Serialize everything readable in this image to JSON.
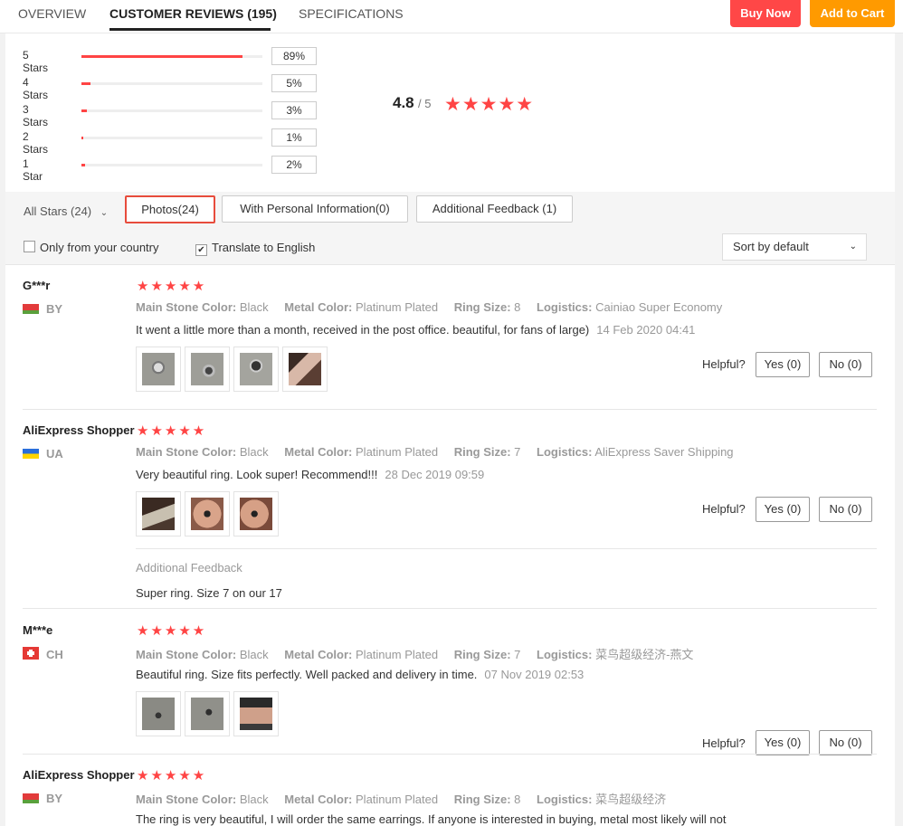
{
  "tabs": {
    "overview": "OVERVIEW",
    "reviews": "CUSTOMER REVIEWS (195)",
    "specs": "SPECIFICATIONS"
  },
  "actions": {
    "buy_now": "Buy Now",
    "add_to_cart": "Add to Cart"
  },
  "rating_breakdown": [
    {
      "label": "5 Stars",
      "percent_text": "89%",
      "percent": 89
    },
    {
      "label": "4 Stars",
      "percent_text": "5%",
      "percent": 5
    },
    {
      "label": "3 Stars",
      "percent_text": "3%",
      "percent": 3
    },
    {
      "label": "2 Stars",
      "percent_text": "1%",
      "percent": 1
    },
    {
      "label": "1 Star",
      "percent_text": "2%",
      "percent": 2
    }
  ],
  "overall": {
    "score": "4.8",
    "out_of": "/ 5",
    "stars": "★★★★★"
  },
  "filters": {
    "all_stars": "All Stars (24)",
    "all_stars_chevron": "⌄",
    "photos": "Photos(24)",
    "personal_info": "With Personal Information(0)",
    "additional_feedback": "Additional Feedback (1)",
    "only_country": "Only from your country",
    "translate": "Translate to English",
    "sort": "Sort by default",
    "sort_chevron": "⌄",
    "translate_check": "✔"
  },
  "labels": {
    "main_stone_color": "Main Stone Color:",
    "metal_color": "Metal Color:",
    "ring_size": "Ring Size:",
    "logistics": "Logistics:",
    "helpful": "Helpful?",
    "additional_feedback": "Additional Feedback"
  },
  "reviews": [
    {
      "name": "G***r",
      "country": "BY",
      "stars": "★★★★★",
      "main_stone_color": "Black",
      "metal_color": "Platinum Plated",
      "ring_size": "8",
      "logistics": "Cainiao Super Economy",
      "comment": "It went a little more than a month, received in the post office. beautiful, for fans of large)",
      "date": "14 Feb 2020 04:41",
      "yes": "Yes (0)",
      "no": "No (0)"
    },
    {
      "name": "AliExpress Shopper",
      "country": "UA",
      "stars": "★★★★★",
      "main_stone_color": "Black",
      "metal_color": "Platinum Plated",
      "ring_size": "7",
      "logistics": "AliExpress Saver Shipping",
      "comment": "Very beautiful ring. Look super! Recommend!!!",
      "date": "28 Dec 2019 09:59",
      "yes": "Yes (0)",
      "no": "No (0)",
      "additional_feedback": "Super ring. Size 7 on our 17"
    },
    {
      "name": "M***e",
      "country": "CH",
      "stars": "★★★★★",
      "main_stone_color": "Black",
      "metal_color": "Platinum Plated",
      "ring_size": "7",
      "logistics": "菜鸟超级经济-燕文",
      "comment": "Beautiful ring. Size fits perfectly. Well packed and delivery in time.",
      "date": "07 Nov 2019 02:53",
      "yes": "Yes (0)",
      "no": "No (0)"
    },
    {
      "name": "AliExpress Shopper",
      "country": "BY",
      "stars": "★★★★★",
      "main_stone_color": "Black",
      "metal_color": "Platinum Plated",
      "ring_size": "8",
      "logistics": "菜鸟超级经济",
      "comment": "The ring is very beautiful, I will order the same earrings. If anyone is interested in buying, metal most likely will not"
    }
  ]
}
